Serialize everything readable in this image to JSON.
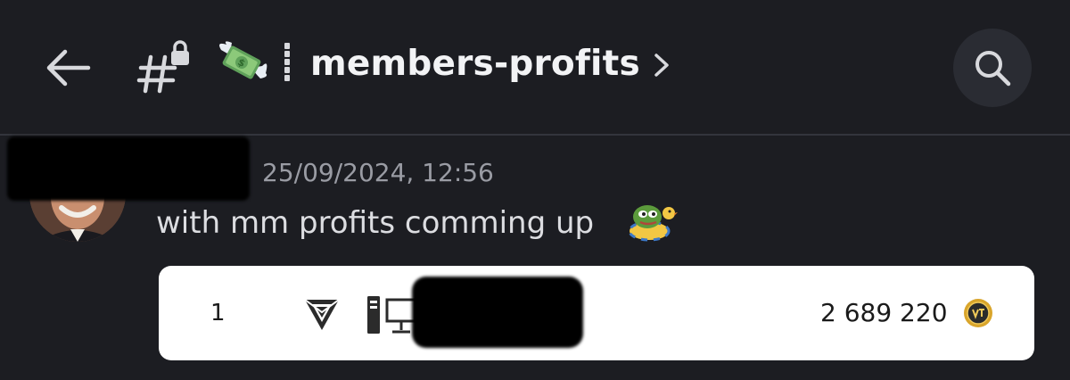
{
  "header": {
    "back_icon": "arrow-left-icon",
    "channel_icon": "locked-hashtag-icon",
    "channel_emoji": "money-with-wings-emoji",
    "channel_name": "members-profits",
    "chevron_icon": "chevron-right-icon",
    "search_icon": "search-icon"
  },
  "message": {
    "timestamp": "25/09/2024, 12:56",
    "text": "with mm profits comming up",
    "emoji": "pepe-swim-ring-emoji"
  },
  "embed": {
    "rank": "1",
    "logo_icon": "triangle-logo-icon",
    "device_icon": "desktop-computer-icon",
    "amount": "2 689 220",
    "currency_icon": "gold-coin-icon"
  },
  "colors": {
    "background": "#1c1d22",
    "header_text": "#f2f3f5",
    "timestamp_text": "#9a9ca4",
    "message_text": "#dcdde1",
    "embed_background": "#ffffff",
    "coin_gold": "#d9a52b"
  }
}
